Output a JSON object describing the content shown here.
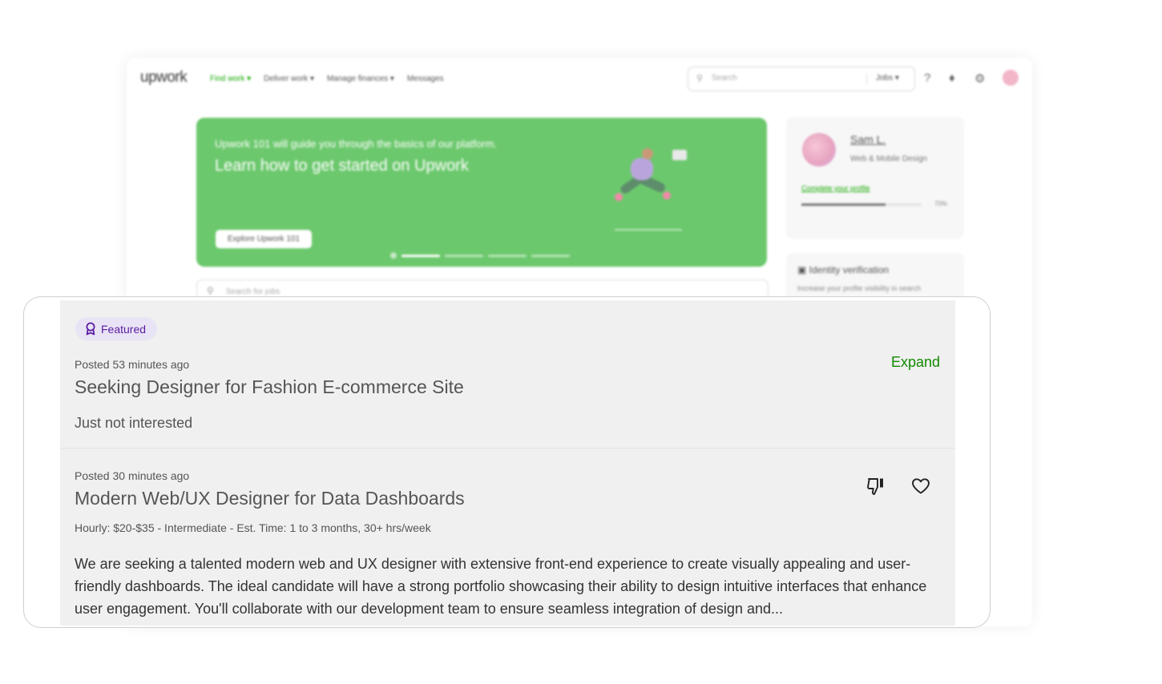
{
  "background": {
    "logo": "upwork",
    "nav": [
      "Find work ▾",
      "Deliver work ▾",
      "Manage finances ▾",
      "Messages"
    ],
    "search_placeholder": "Search",
    "search_scope": "Jobs ▾",
    "banner": {
      "subtitle": "Upwork 101 will guide you through the basics of our platform.",
      "title": "Learn how to get started on Upwork",
      "button": "Explore Upwork 101"
    },
    "profile": {
      "name": "Sam L.",
      "role": "Web & Mobile Design",
      "link": "Complete your profile",
      "completion": 0.7,
      "completion_label": "70%"
    },
    "identity": {
      "title": "Identity verification",
      "desc": "Increase your profile visibility in search"
    },
    "job_search_placeholder": "Search for jobs"
  },
  "featured": {
    "badge": "Featured",
    "posted": "Posted 53 minutes ago",
    "title": "Seeking Designer for Fashion E-commerce Site",
    "expand": "Expand",
    "feedback": "Just not interested"
  },
  "job": {
    "posted": "Posted 30 minutes ago",
    "title": "Modern Web/UX Designer for Data Dashboards",
    "meta": "Hourly: $20-$35 - Intermediate - Est. Time: 1 to 3 months, 30+ hrs/week",
    "description": "We are seeking a talented modern web and UX designer with extensive front-end experience to create visually appealing and user-friendly dashboards. The ideal candidate will have a strong portfolio showcasing their ability to design intuitive interfaces that enhance user engagement. You'll collaborate with our development team to ensure seamless integration of design and..."
  },
  "icons": {
    "badge": "ribbon-icon",
    "dislike": "thumbs-down-icon",
    "save": "heart-icon"
  },
  "colors": {
    "brand_green": "#14a800",
    "link_green": "#108a00",
    "banner_green": "#6cc86d",
    "badge_bg": "#e9e4f5",
    "badge_text": "#5b1ba0"
  }
}
